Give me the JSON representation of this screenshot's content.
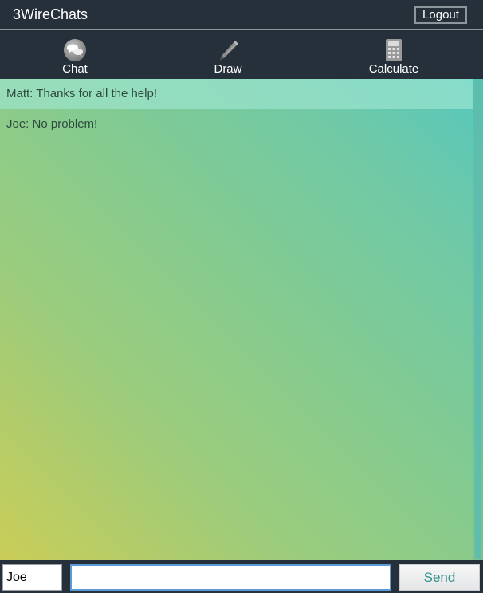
{
  "header": {
    "title": "3WireChats",
    "logout_label": "Logout"
  },
  "nav": {
    "tabs": [
      {
        "label": "Chat",
        "icon": "chat-bubbles-icon"
      },
      {
        "label": "Draw",
        "icon": "pencil-icon"
      },
      {
        "label": "Calculate",
        "icon": "calculator-icon"
      }
    ]
  },
  "chat": {
    "messages": [
      {
        "text": "Matt: Thanks for all the help!",
        "highlighted": true
      },
      {
        "text": "Joe: No problem!",
        "highlighted": false
      }
    ]
  },
  "composer": {
    "name_value": "Joe",
    "message_value": "",
    "send_label": "Send"
  },
  "colors": {
    "header_bg": "#26303a",
    "send_text": "#2f8e8a",
    "gradient_start": "#cacd57",
    "gradient_end": "#56c8bd"
  }
}
